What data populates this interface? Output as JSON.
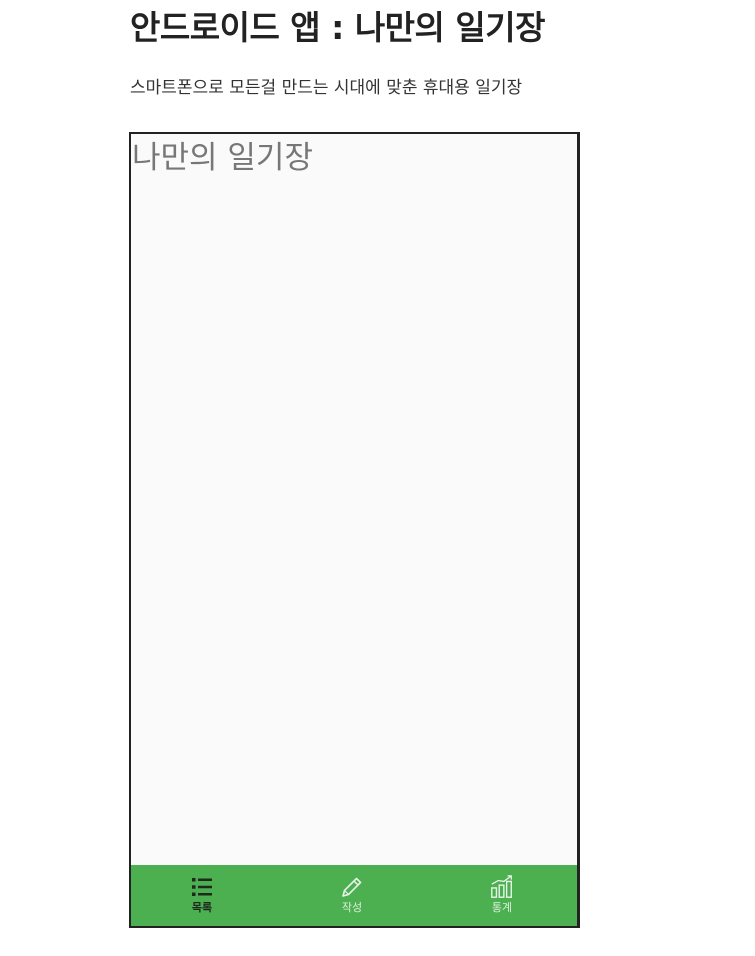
{
  "page": {
    "title": "안드로이드 앱 : 나만의 일기장",
    "subtitle": "스마트폰으로 모든걸 만드는 시대에 맞춘 휴대용 일기장"
  },
  "app": {
    "title": "나만의 일기장",
    "colors": {
      "nav_background": "#4caf50",
      "screen_background": "#fafafa",
      "frame_border": "#222222",
      "active_icon": "#1f2a1f",
      "inactive_icon": "#e8f5e9"
    },
    "bottom_nav": [
      {
        "label": "목록",
        "icon": "list-icon",
        "active": true
      },
      {
        "label": "작성",
        "icon": "pencil-icon",
        "active": false
      },
      {
        "label": "통계",
        "icon": "bar-chart-icon",
        "active": false
      }
    ]
  }
}
